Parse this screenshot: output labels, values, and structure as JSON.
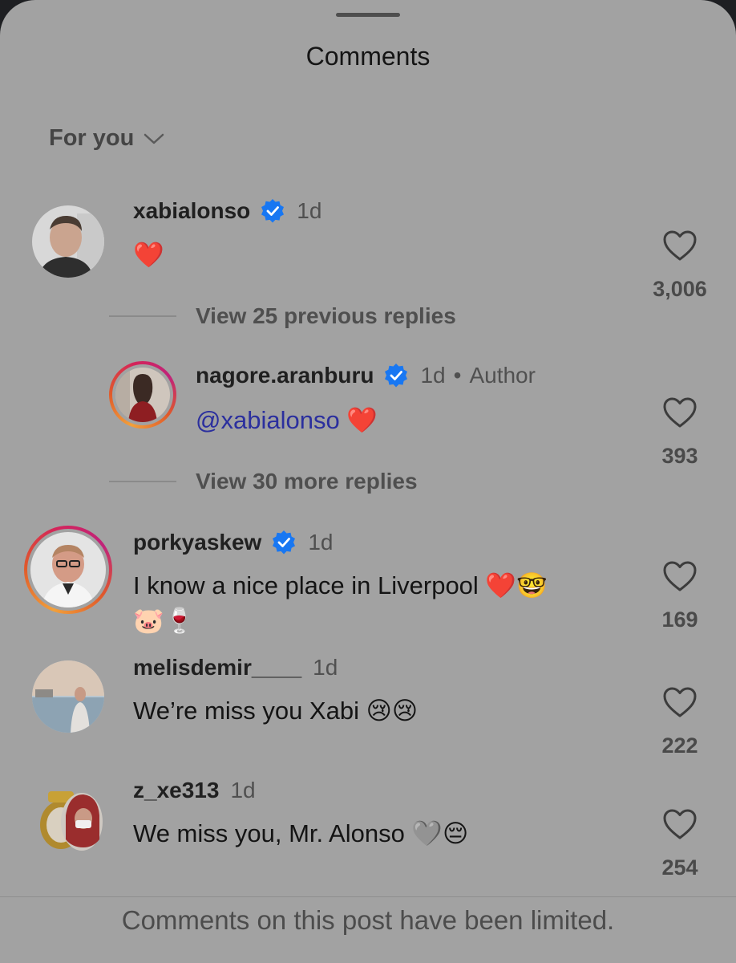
{
  "header": {
    "title": "Comments",
    "filter_label": "For you"
  },
  "comments": [
    {
      "username": "xabialonso",
      "verified": true,
      "time": "1d",
      "text": "❤️",
      "likes": "3,006",
      "avatar": "avatar-photo"
    },
    {
      "username": "nagore.aranburu",
      "verified": true,
      "time": "1d",
      "badge": "Author",
      "mention": "@xabialonso",
      "text": "❤️",
      "likes": "393",
      "avatar": "avatar-photo-story-ring"
    },
    {
      "username": "porkyaskew",
      "verified": true,
      "time": "1d",
      "text_line1": "I know a nice place in Liverpool ❤️🤓",
      "text_line2": "🐷🍷",
      "likes": "169",
      "avatar": "avatar-photo-story-ring"
    },
    {
      "username": "melisdemir____",
      "verified": false,
      "time": "1d",
      "text": "We’re miss you Xabi 😢😢",
      "likes": "222",
      "avatar": "avatar-photo"
    },
    {
      "username": "z_xe313",
      "verified": false,
      "time": "1d",
      "text": "We miss you, Mr. Alonso 🩶😔",
      "likes": "254",
      "avatar": "avatar-photo"
    }
  ],
  "reply_links": {
    "previous": "View 25 previous replies",
    "more": "View 30 more replies"
  },
  "footer": {
    "notice": "Comments on this post have been limited."
  },
  "colors": {
    "sheet_background": "#a2a2a2",
    "verified_blue": "#1877f2",
    "mention": "#2b2f9e"
  },
  "icons": {
    "like": "heart-outline-icon",
    "verified": "verified-badge-icon",
    "filter": "chevron-down-icon"
  }
}
